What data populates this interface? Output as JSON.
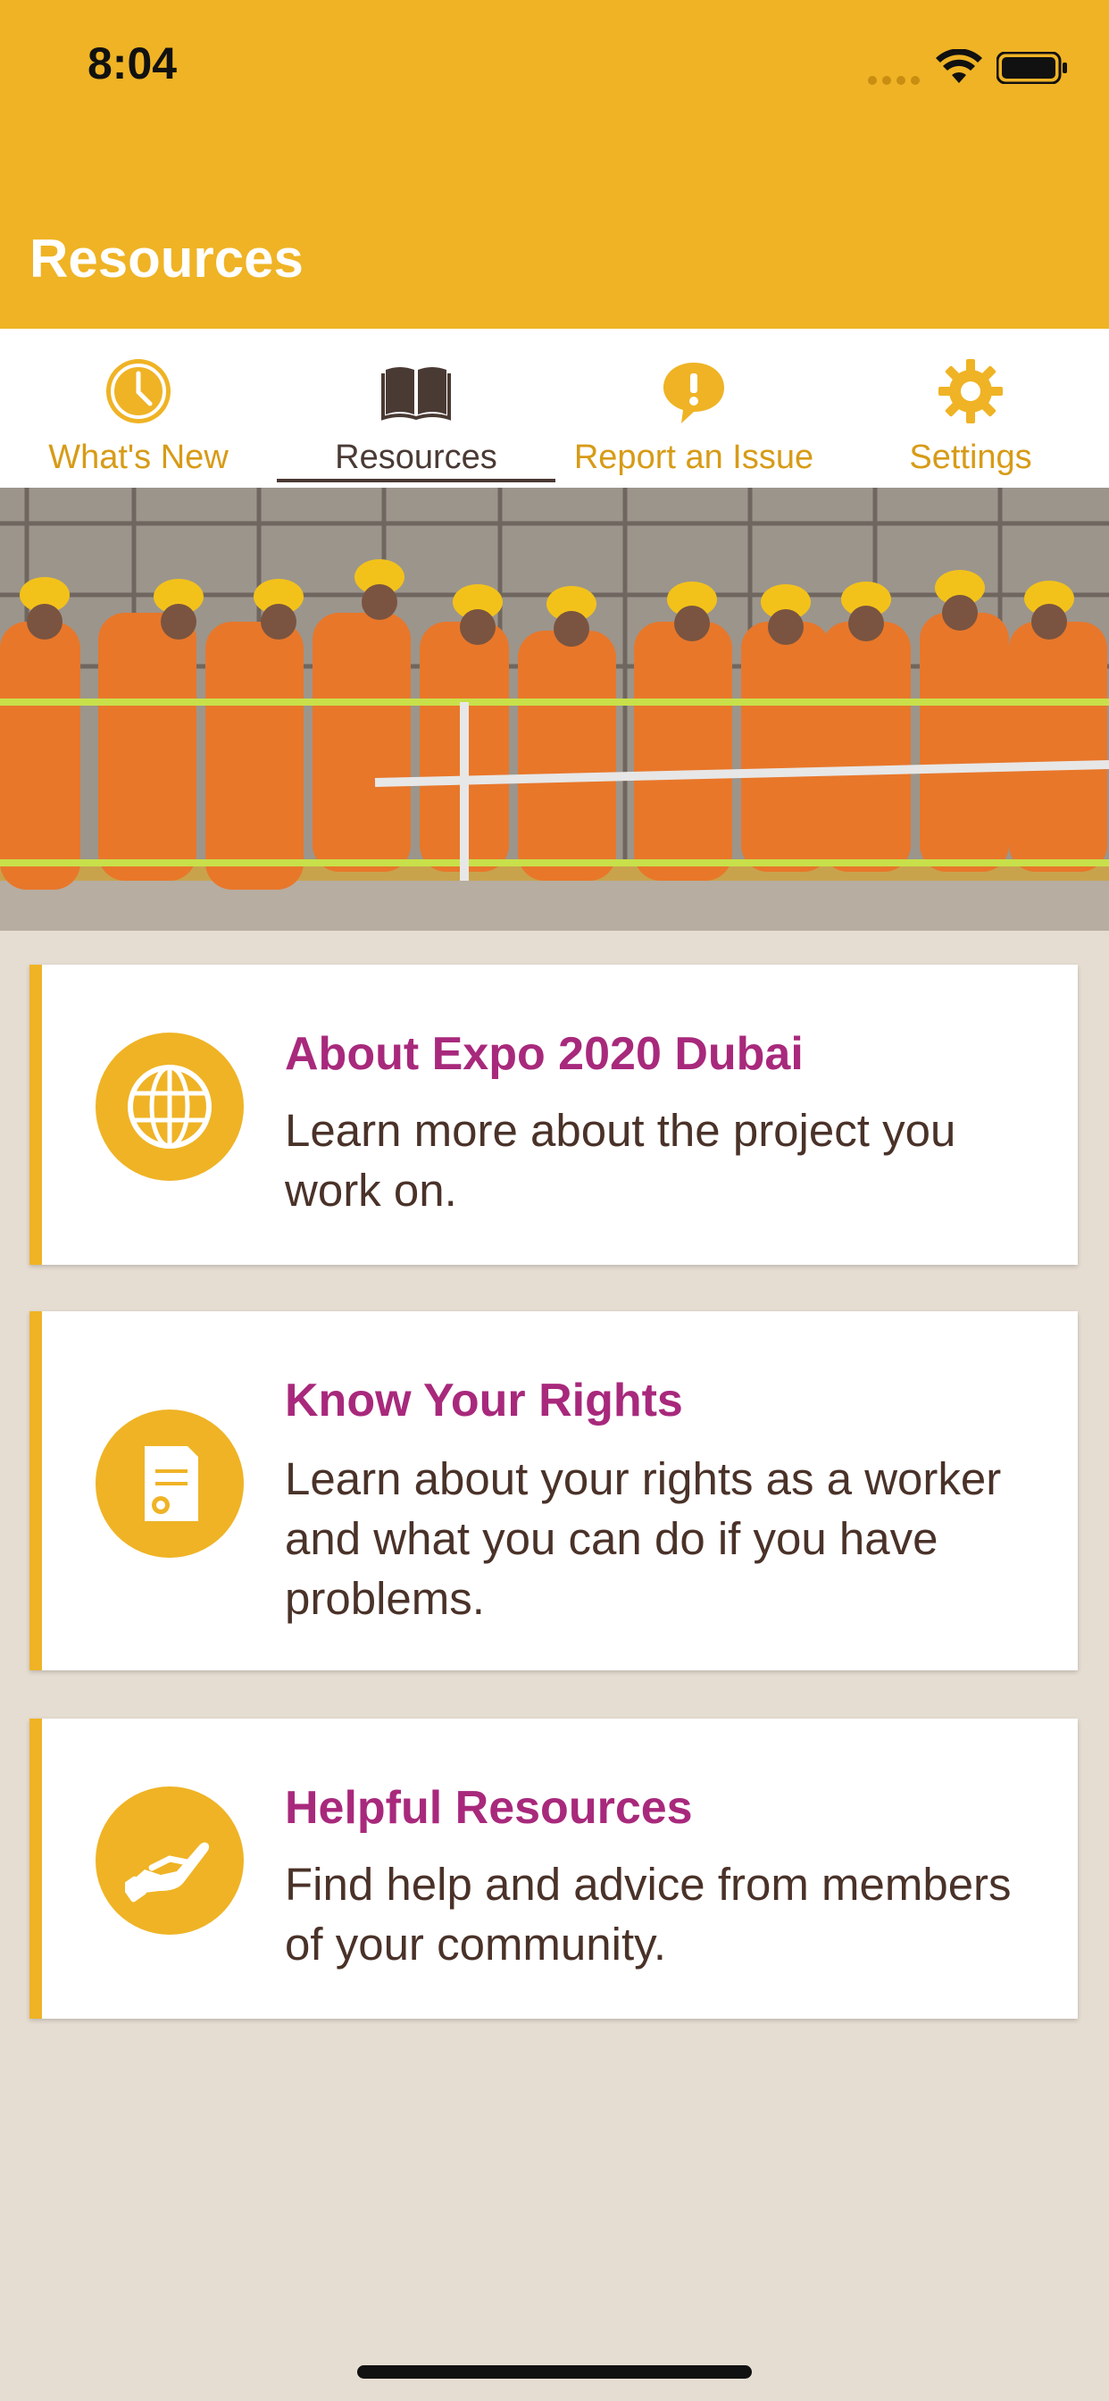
{
  "status_bar": {
    "time": "8:04"
  },
  "header": {
    "title": "Resources"
  },
  "tabs": [
    {
      "label": "What's New",
      "icon": "clock-icon",
      "active": false
    },
    {
      "label": "Resources",
      "icon": "book-icon",
      "active": true
    },
    {
      "label": "Report an Issue",
      "icon": "alert-bubble-icon",
      "active": false
    },
    {
      "label": "Settings",
      "icon": "gear-icon",
      "active": false
    }
  ],
  "hero": {
    "image": "group of construction workers in orange coveralls and yellow hard hats raising hands"
  },
  "cards": [
    {
      "title": "About Expo 2020 Dubai",
      "description": "Learn more about the project you work on.",
      "icon": "globe-icon"
    },
    {
      "title": "Know Your Rights",
      "description": "Learn about your rights as a worker and what you can do if you have problems.",
      "icon": "certificate-icon"
    },
    {
      "title": "Helpful Resources",
      "description": "Find help and advice from members of your community.",
      "icon": "helping-hand-icon"
    }
  ],
  "colors": {
    "brand": "#efb325",
    "title_accent": "#a8297c",
    "text_dark": "#4a3229",
    "background": "#e6ddd2"
  }
}
